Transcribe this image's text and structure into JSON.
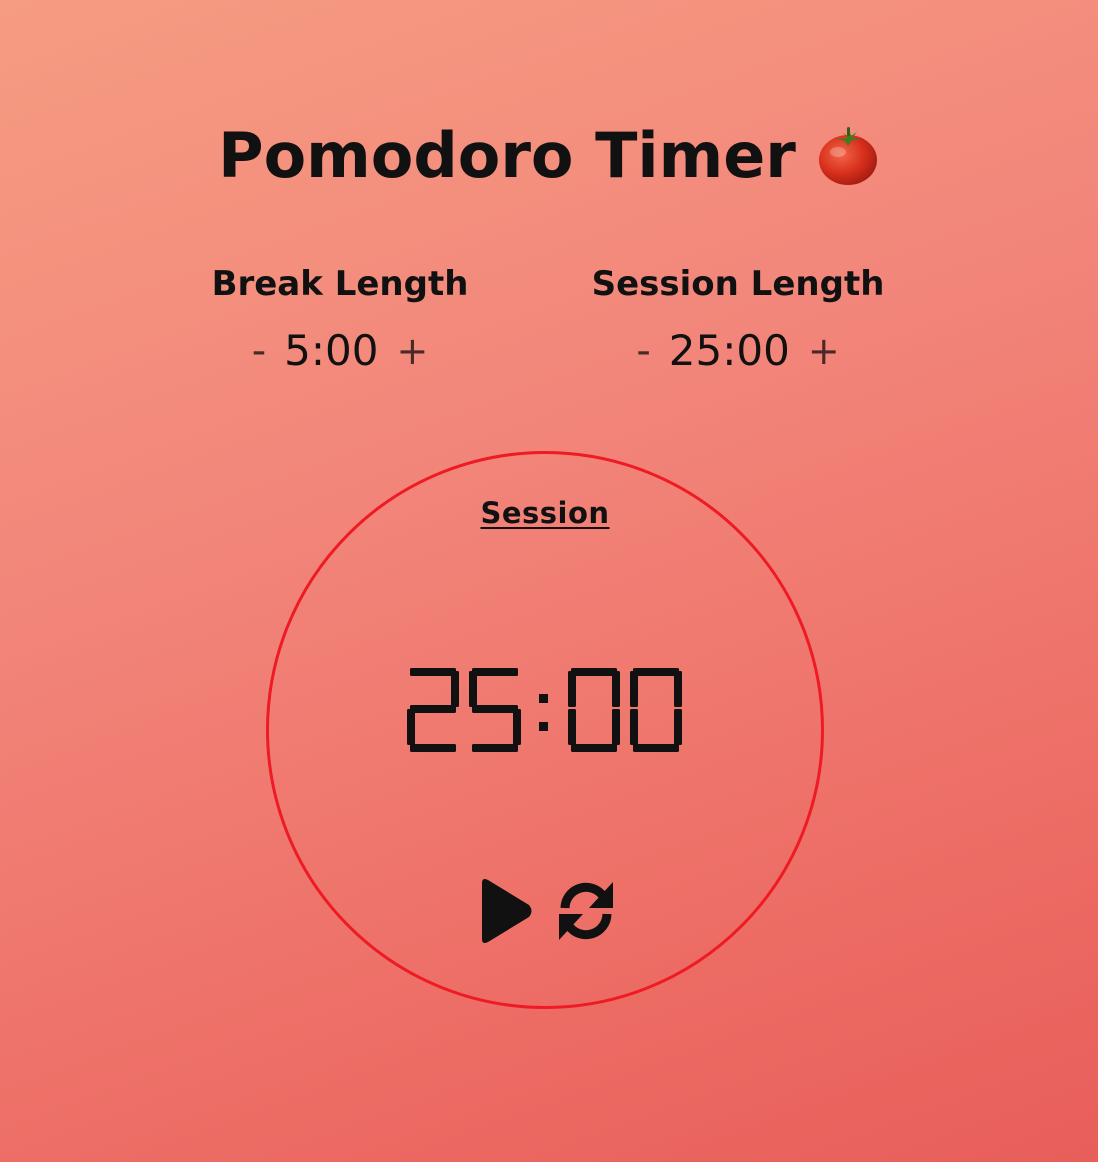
{
  "app": {
    "title": "Pomodoro Timer"
  },
  "break_control": {
    "label": "Break Length",
    "decrement": "-",
    "value": "5:00",
    "increment": "+"
  },
  "session_control": {
    "label": "Session Length",
    "decrement": "-",
    "value": "25:00",
    "increment": "+"
  },
  "timer": {
    "label": "Session",
    "display": "25:00"
  },
  "icons": {
    "title_emoji": "tomato-icon",
    "start": "play-icon",
    "reset": "refresh-icon"
  },
  "colors": {
    "ring": "#ee1b24",
    "text": "#111111"
  }
}
